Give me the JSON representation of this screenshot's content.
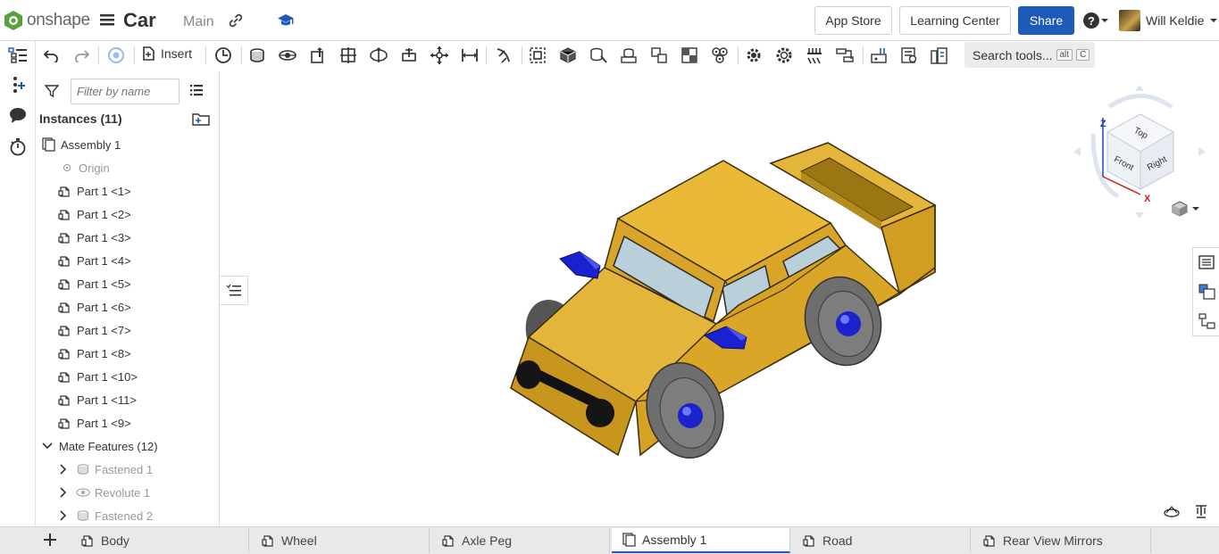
{
  "header": {
    "logo_text": "onshape",
    "doc_title": "Car",
    "branch": "Main",
    "app_store_label": "App Store",
    "learning_center_label": "Learning Center",
    "share_label": "Share",
    "user_name": "Will Keldie"
  },
  "toolbar": {
    "insert_label": "Insert",
    "search_label": "Search tools...",
    "search_shortcut_1": "alt",
    "search_shortcut_2": "C"
  },
  "panel": {
    "filter_placeholder": "Filter by name",
    "instances_title": "Instances (11)",
    "assembly_label": "Assembly 1",
    "origin_label": "Origin",
    "parts": [
      "Part 1 <1>",
      "Part 1 <2>",
      "Part 1 <3>",
      "Part 1 <4>",
      "Part 1 <5>",
      "Part 1 <6>",
      "Part 1 <7>",
      "Part 1 <8>",
      "Part 1 <10>",
      "Part 1 <11>",
      "Part 1 <9>"
    ],
    "mate_features_title": "Mate Features (12)",
    "mates": [
      "Fastened 1",
      "Revolute 1",
      "Fastened 2"
    ]
  },
  "viewcube": {
    "top": "Top",
    "front": "Front",
    "right": "Right",
    "axis_z": "Z",
    "axis_x": "X"
  },
  "tabs": [
    {
      "label": "Body"
    },
    {
      "label": "Wheel"
    },
    {
      "label": "Axle Peg"
    },
    {
      "label": "Assembly 1"
    },
    {
      "label": "Road"
    },
    {
      "label": "Rear View Mirrors"
    }
  ],
  "colors": {
    "accent": "#1e5bb8",
    "car_body": "#e0b030",
    "mirror_blue": "#1a22d0",
    "wheel_gray": "#6e6e6e"
  }
}
